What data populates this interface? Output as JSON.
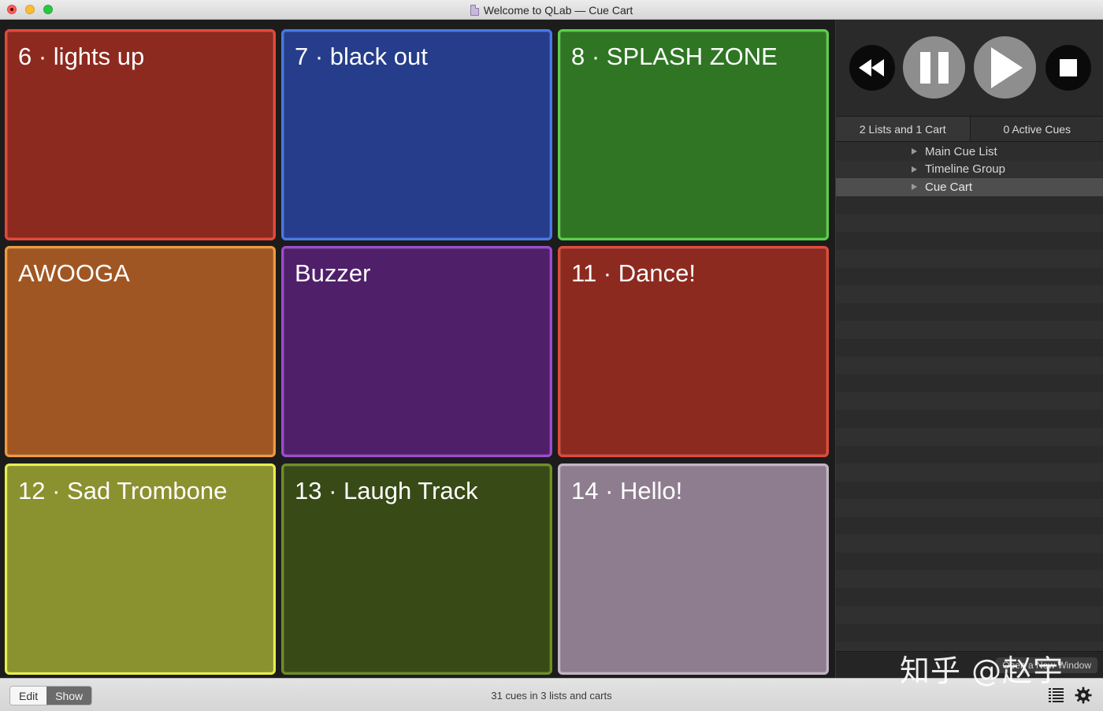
{
  "window": {
    "title": "Welcome to QLab — Cue Cart"
  },
  "cart": {
    "tiles": [
      {
        "label": "6 · lights up",
        "bg": "#8d2a1f",
        "border": "#e5493a"
      },
      {
        "label": "7 · black out",
        "bg": "#253d8a",
        "border": "#4a78e8"
      },
      {
        "label": "8 · SPLASH ZONE",
        "bg": "#2f7524",
        "border": "#5ad148"
      },
      {
        "label": "AWOOGA",
        "bg": "#a05622",
        "border": "#f19a3c"
      },
      {
        "label": "Buzzer",
        "bg": "#4f1f6a",
        "border": "#9e4bd2"
      },
      {
        "label": "11 · Dance!",
        "bg": "#8d2a1f",
        "border": "#e5493a"
      },
      {
        "label": "12 · Sad Trombone",
        "bg": "#8a912f",
        "border": "#e8ef4a"
      },
      {
        "label": "13 · Laugh Track",
        "bg": "#384a16",
        "border": "#6e8f25"
      },
      {
        "label": "14 · Hello!",
        "bg": "#8e7d8f",
        "border": "#c2b5c3"
      }
    ]
  },
  "transport": {
    "rewind": "rewind-icon",
    "pause": "pause-icon",
    "play": "play-icon",
    "stop": "stop-icon"
  },
  "sidebar": {
    "tabs": [
      {
        "label": "2 Lists and 1 Cart"
      },
      {
        "label": "0 Active Cues"
      }
    ],
    "lists": [
      {
        "label": "Main Cue List"
      },
      {
        "label": "Timeline Group"
      },
      {
        "label": "Cue Cart"
      }
    ],
    "new_window_label": "Open a New Window"
  },
  "statusbar": {
    "edit_label": "Edit",
    "show_label": "Show",
    "summary": "31 cues in 3 lists and carts"
  },
  "watermark": "知乎 @赵宇"
}
